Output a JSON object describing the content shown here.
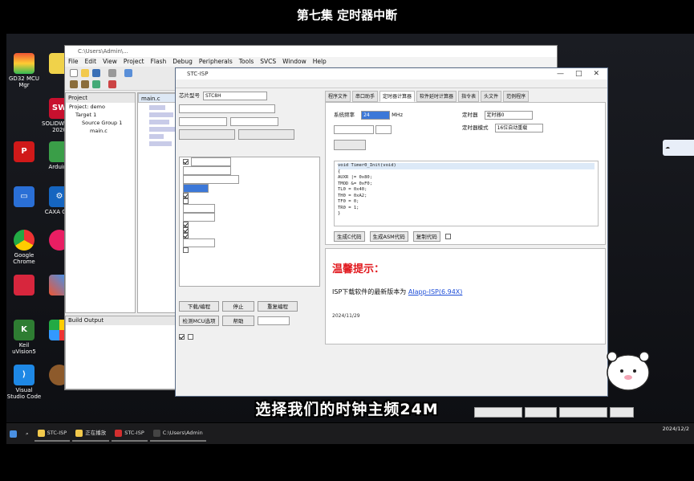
{
  "video": {
    "title": "第七集 定时器中断",
    "subtitle": "选择我们的时钟主频24M"
  },
  "desktop": {
    "icons_col1": [
      "GD32 MCU Mgr",
      "SOLIDWORKS 2020",
      "",
      "",
      "Google Chrome",
      "",
      "Keil uVision5",
      "Visual Studio Code"
    ],
    "icons_col2": [
      "",
      "",
      "Arduino",
      "CAXA CAD",
      "",
      "",
      "",
      ""
    ]
  },
  "keil": {
    "title": "C:\\Users\\Admin\\...",
    "menu": [
      "File",
      "Edit",
      "View",
      "Project",
      "Flash",
      "Debug",
      "Peripherals",
      "Tools",
      "SVCS",
      "Window",
      "Help"
    ],
    "project_header": "Project",
    "tree": [
      "Project: demo",
      "Target 1",
      "Source Group 1",
      "main.c"
    ],
    "editor_tab": "main.c",
    "build_output": "Build Output"
  },
  "isp": {
    "title": "STC-ISP",
    "window_buttons": [
      "—",
      "□",
      "✕"
    ],
    "chip_label": "芯片型号",
    "chip_value": "STC8H",
    "left_buttons": {
      "download": "下载/编程",
      "stop": "停止",
      "repeat": "重复编程",
      "check": "检测MCU选项",
      "help": "帮助"
    },
    "tabs": [
      "程序文件",
      "串口助手",
      "定时器计算器",
      "软件延时计算器",
      "指令表",
      "头文件",
      "范例程序"
    ],
    "calc": {
      "sysfreq_label": "系统频率",
      "sysfreq_value": "24",
      "sysfreq_unit": "MHz",
      "timer_label": "定时器",
      "timer_value": "定时器0",
      "mode_label": "定时器模式",
      "mode_value": "16位自动重载",
      "code_lines": [
        "void Timer0_Init(void)",
        "{",
        "    AUXR |= 0x80;",
        "    TMOD &= 0xF0;",
        "    TL0 = 0x40;",
        "    TH0 = 0xA2;",
        "    TF0 = 0;",
        "    TR0 = 1;",
        "}"
      ],
      "buttons": [
        "生成C代码",
        "生成ASM代码",
        "复制代码"
      ]
    },
    "hint": {
      "heading": "温馨提示：",
      "line1_prefix": "ISP下载软件的最新版本为",
      "line1_link": "AIapp-ISP(6.94X)",
      "date": "2024/11/29"
    }
  },
  "taskbar": {
    "apps": [
      "STC-ISP",
      "正在播放",
      "STC-ISP",
      "C:\\Users\\Admin"
    ],
    "date": "2024/12/2"
  },
  "colors": {
    "link": "#1f4fd8",
    "hint_red": "#e1191e",
    "taskbar": "#1c1c1e"
  }
}
